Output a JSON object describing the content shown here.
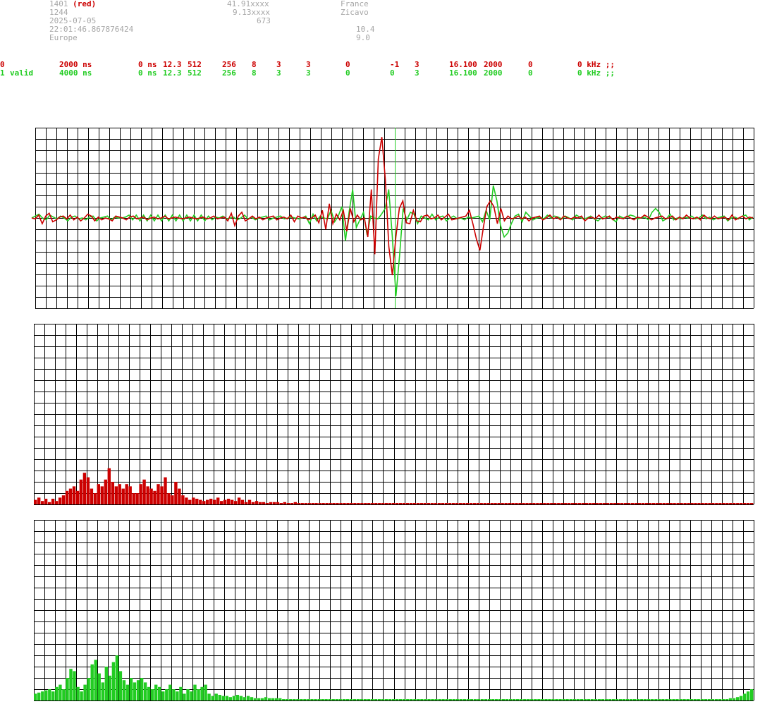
{
  "station": {
    "id": "1401",
    "id_color_tag": "(red)",
    "number": "1244",
    "date": "2025-07-05",
    "time": "22:01:46.867876424",
    "region": "Europe",
    "lat": "41.91xxxx",
    "lon": "9.13xxxx",
    "alt": "673",
    "country": "France",
    "place": "Zicavo",
    "val1": "10.4",
    "val2": "9.0"
  },
  "channels": [
    {
      "ch": "0",
      "status": "",
      "sample": "2000 ns",
      "offset": "0 ns",
      "gain": "12.3",
      "n1": "512",
      "n2": "256",
      "n3": "8",
      "n4": "3",
      "n5": "3",
      "n6": "0",
      "n7": "-1",
      "n8": "3",
      "n9": "16.100",
      "n10": "2000",
      "n11": "0",
      "freq": "0 kHz ;;",
      "color": "#cc0000"
    },
    {
      "ch": "1",
      "status": "valid",
      "sample": "4000 ns",
      "offset": "0 ns",
      "gain": "12.3",
      "n1": "512",
      "n2": "256",
      "n3": "8",
      "n4": "3",
      "n5": "3",
      "n6": "0",
      "n7": "0",
      "n8": "3",
      "n9": "16.100",
      "n10": "2000",
      "n11": "0",
      "freq": "0 kHz ;;",
      "color": "#22cc22"
    }
  ],
  "colors": {
    "red": "#cc0000",
    "green": "#22cc22",
    "grid": "#000000"
  },
  "chart_data": [
    {
      "type": "line",
      "series": [
        {
          "values": [
            0,
            -1,
            3,
            -6,
            2,
            5,
            -4,
            -2,
            1,
            2,
            -1,
            3,
            -2,
            1,
            -3,
            0,
            4,
            2,
            -3,
            1,
            -2,
            0,
            -1,
            -3,
            2,
            1,
            0,
            -2,
            1,
            2,
            -1,
            0,
            1,
            -2,
            0,
            1,
            -1,
            0,
            2,
            -1,
            0,
            1,
            0,
            -1,
            0,
            1,
            0,
            -1,
            0,
            1,
            -1,
            0,
            2,
            -1,
            0,
            1,
            -3,
            5,
            -8,
            2,
            6,
            -3,
            -1,
            2,
            -1,
            1,
            -2,
            0,
            1,
            2,
            -2,
            0,
            1,
            -1,
            3,
            -4,
            2,
            0,
            1,
            -2,
            0,
            3,
            -5,
            8,
            -12,
            15,
            -6,
            4,
            -2,
            8,
            -14,
            10,
            -4,
            3,
            -2,
            0,
            -20,
            30,
            -38,
            62,
            85,
            40,
            -30,
            -60,
            -20,
            10,
            18,
            -5,
            -6,
            8,
            -3,
            -4,
            2,
            3,
            -1,
            0,
            3,
            -2,
            1,
            4,
            -2,
            -1,
            0,
            1,
            2,
            8,
            -6,
            -22,
            -34,
            -10,
            12,
            18,
            12,
            -6,
            10,
            -3,
            2,
            -1,
            0,
            2,
            -1,
            1,
            -3,
            0,
            1,
            2,
            -2,
            0,
            3,
            -1,
            1,
            -2,
            2,
            0,
            -1,
            1,
            0,
            2,
            -3,
            0,
            1,
            -1,
            3,
            -1,
            0,
            2,
            -2,
            1,
            0,
            -1,
            2,
            0,
            -2,
            1,
            0,
            3,
            1,
            -2,
            0,
            1,
            2,
            -1,
            0,
            2,
            -2,
            1,
            -1,
            3,
            0,
            -1,
            1,
            -2,
            3,
            0,
            -1,
            2,
            -1,
            0,
            1,
            -2,
            3,
            -2,
            0,
            2,
            -1,
            1,
            0
          ]
        },
        {
          "values": [
            0,
            2,
            4,
            0,
            -2,
            3,
            1,
            -1,
            2,
            0,
            -3,
            1,
            2,
            -1,
            0,
            -2,
            1,
            2,
            -3,
            0,
            1,
            2,
            -2,
            1,
            0,
            0,
            1,
            3,
            -2,
            3,
            -3,
            3,
            -3,
            3,
            -3,
            3,
            -3,
            3,
            -3,
            3,
            -3,
            3,
            -3,
            3,
            -3,
            3,
            -3,
            3,
            -3,
            2,
            -2,
            1,
            0,
            2,
            -1,
            0,
            1,
            -2,
            0,
            3,
            -1,
            1,
            -2,
            0,
            1,
            2,
            -2,
            0,
            1,
            2,
            -1,
            0,
            1,
            0,
            -1,
            0,
            2,
            -6,
            4,
            -3,
            2,
            0,
            -1,
            8,
            -4,
            2,
            12,
            -24,
            6,
            30,
            -10,
            -2,
            6,
            -18,
            2,
            0,
            -1,
            4,
            10,
            30,
            -20,
            -82,
            -40,
            10,
            -2,
            6,
            4,
            -6,
            2,
            0,
            -2,
            4,
            -2,
            1,
            2,
            -3,
            0,
            2,
            -1,
            0,
            -2,
            1,
            0,
            1,
            2,
            -4,
            8,
            -2,
            34,
            18,
            -8,
            -20,
            -16,
            -6,
            2,
            4,
            -4,
            6,
            2,
            -2,
            0,
            1,
            -1,
            3,
            0,
            2,
            1,
            -1,
            2,
            0,
            -2,
            3,
            1,
            -1,
            0,
            2,
            -1,
            -3,
            0,
            2,
            1,
            -1,
            -4,
            2,
            0,
            1,
            3,
            2,
            -1,
            0,
            1,
            -2,
            6,
            10,
            6,
            -3,
            -1,
            4,
            -2,
            0,
            -1,
            1,
            0,
            2,
            -1,
            0,
            3,
            -1,
            1,
            -2,
            0,
            1,
            2,
            -3,
            0,
            1,
            -1,
            2,
            3,
            -2,
            1
          ]
        }
      ]
    },
    {
      "type": "bar",
      "values": [
        4,
        6,
        3,
        5,
        2,
        5,
        3,
        6,
        8,
        12,
        14,
        16,
        12,
        22,
        28,
        24,
        14,
        10,
        18,
        16,
        22,
        32,
        20,
        16,
        18,
        14,
        18,
        16,
        10,
        10,
        18,
        22,
        16,
        14,
        12,
        18,
        16,
        24,
        10,
        8,
        20,
        14,
        8,
        6,
        4,
        6,
        5,
        4,
        3,
        4,
        5,
        4,
        6,
        3,
        4,
        5,
        4,
        3,
        6,
        4,
        2,
        4,
        2,
        3,
        2,
        2,
        1,
        2,
        2,
        2,
        1,
        2,
        1,
        1,
        2,
        1,
        1,
        1,
        1,
        1,
        1,
        1,
        1,
        1,
        1,
        1,
        1,
        1,
        1,
        1,
        1,
        1,
        1,
        1,
        1,
        1,
        1,
        1,
        1,
        1,
        1,
        1,
        1,
        1,
        1,
        1,
        1,
        1,
        1,
        1,
        1,
        1,
        1,
        1,
        1,
        1,
        1,
        1,
        1,
        1,
        1,
        1,
        1,
        1,
        1,
        1,
        1,
        1,
        1,
        1,
        1,
        1,
        1,
        1,
        1,
        1,
        1,
        1,
        1,
        1,
        1,
        1,
        1,
        1,
        1,
        1,
        1,
        1,
        1,
        1,
        1,
        1,
        1,
        1,
        1,
        1,
        1,
        1,
        1,
        1,
        1,
        1,
        1,
        1,
        1,
        1,
        1,
        1,
        1,
        1,
        1,
        1,
        1,
        1,
        1,
        1,
        1,
        1,
        1,
        1,
        1,
        1,
        1,
        1,
        1,
        1,
        1,
        1,
        1,
        1,
        1,
        1,
        1,
        1,
        1,
        1,
        1,
        1,
        1,
        1,
        1,
        1,
        1,
        1,
        1
      ]
    },
    {
      "type": "bar",
      "values": [
        6,
        7,
        8,
        9,
        10,
        8,
        12,
        14,
        10,
        20,
        28,
        26,
        12,
        8,
        14,
        20,
        32,
        36,
        24,
        16,
        30,
        22,
        34,
        40,
        26,
        18,
        14,
        20,
        16,
        18,
        20,
        16,
        12,
        10,
        14,
        12,
        8,
        10,
        14,
        10,
        8,
        12,
        6,
        10,
        8,
        14,
        10,
        12,
        14,
        6,
        4,
        6,
        5,
        4,
        4,
        3,
        4,
        5,
        4,
        3,
        4,
        3,
        2,
        2,
        2,
        3,
        2,
        2,
        2,
        2,
        1,
        1,
        1,
        1,
        1,
        1,
        1,
        1,
        1,
        1,
        1,
        1,
        1,
        1,
        1,
        1,
        1,
        1,
        1,
        1,
        1,
        1,
        1,
        1,
        1,
        1,
        1,
        1,
        1,
        1,
        1,
        1,
        1,
        1,
        1,
        1,
        1,
        1,
        1,
        1,
        1,
        1,
        1,
        1,
        1,
        1,
        1,
        1,
        1,
        1,
        1,
        1,
        1,
        1,
        1,
        1,
        1,
        1,
        1,
        1,
        1,
        1,
        1,
        1,
        1,
        1,
        1,
        1,
        1,
        1,
        1,
        1,
        1,
        1,
        1,
        1,
        1,
        1,
        1,
        1,
        1,
        1,
        1,
        1,
        1,
        1,
        1,
        1,
        1,
        1,
        1,
        1,
        1,
        1,
        1,
        1,
        1,
        1,
        1,
        1,
        1,
        1,
        1,
        1,
        1,
        1,
        1,
        1,
        1,
        1,
        1,
        1,
        1,
        1,
        1,
        1,
        1,
        1,
        1,
        1,
        1,
        1,
        1,
        1,
        1,
        1,
        2,
        2,
        3,
        4,
        6,
        8,
        10
      ]
    }
  ]
}
